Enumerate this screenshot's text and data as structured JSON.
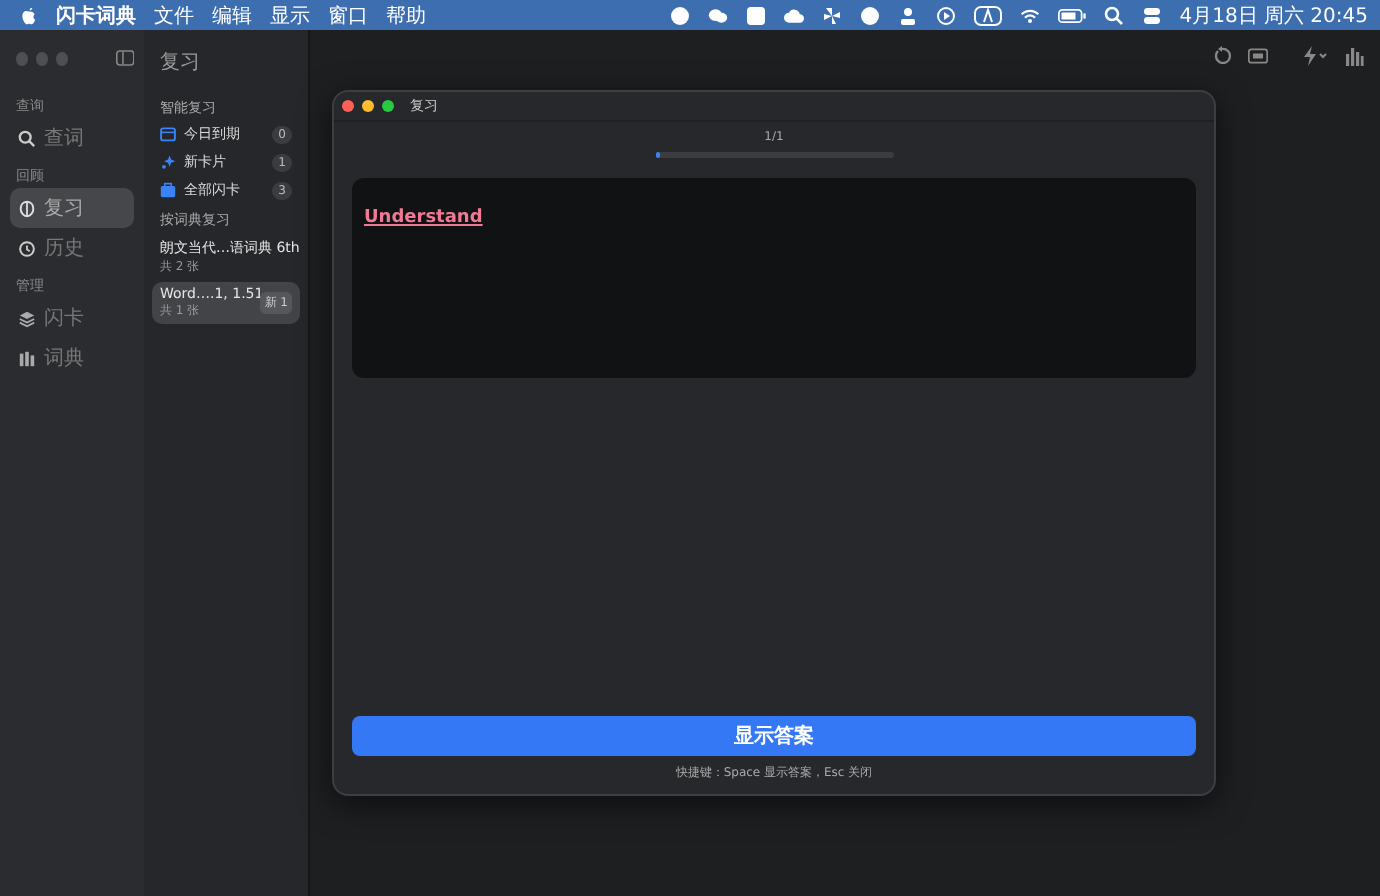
{
  "menubar": {
    "app_name": "闪卡词典",
    "menus": [
      "文件",
      "编辑",
      "显示",
      "窗口",
      "帮助"
    ],
    "clock": "4月18日 周六 20:45"
  },
  "sidebar": {
    "sections": [
      {
        "title": "查询",
        "items": [
          {
            "label": "查词",
            "kind": "search",
            "selected": false
          }
        ]
      },
      {
        "title": "回顾",
        "items": [
          {
            "label": "复习",
            "kind": "review",
            "selected": true
          },
          {
            "label": "历史",
            "kind": "history",
            "selected": false
          }
        ]
      },
      {
        "title": "管理",
        "items": [
          {
            "label": "闪卡",
            "kind": "cards",
            "selected": false
          },
          {
            "label": "词典",
            "kind": "dict",
            "selected": false
          }
        ]
      }
    ]
  },
  "list": {
    "title": "复习",
    "smart_title": "智能复习",
    "smart_items": [
      {
        "label": "今日到期",
        "kind": "calendar",
        "count": "0"
      },
      {
        "label": "新卡片",
        "kind": "sparkle",
        "count": "1"
      },
      {
        "label": "全部闪卡",
        "kind": "box",
        "count": "3"
      }
    ],
    "dict_title": "按词典复习",
    "dict_items": [
      {
        "name": "朗文当代…语词典 6th",
        "sub": "共 2 张",
        "selected": false
      },
      {
        "name": "Word….1, 1.51",
        "sub": "共 1 张",
        "badge": "新 1",
        "selected": true
      }
    ]
  },
  "modal": {
    "title": "复习",
    "progress_text": "1/1",
    "level": 0.02,
    "word": "Understand",
    "button": "显示答案",
    "hint": "快捷键：Space 显示答案，Esc 关闭"
  }
}
